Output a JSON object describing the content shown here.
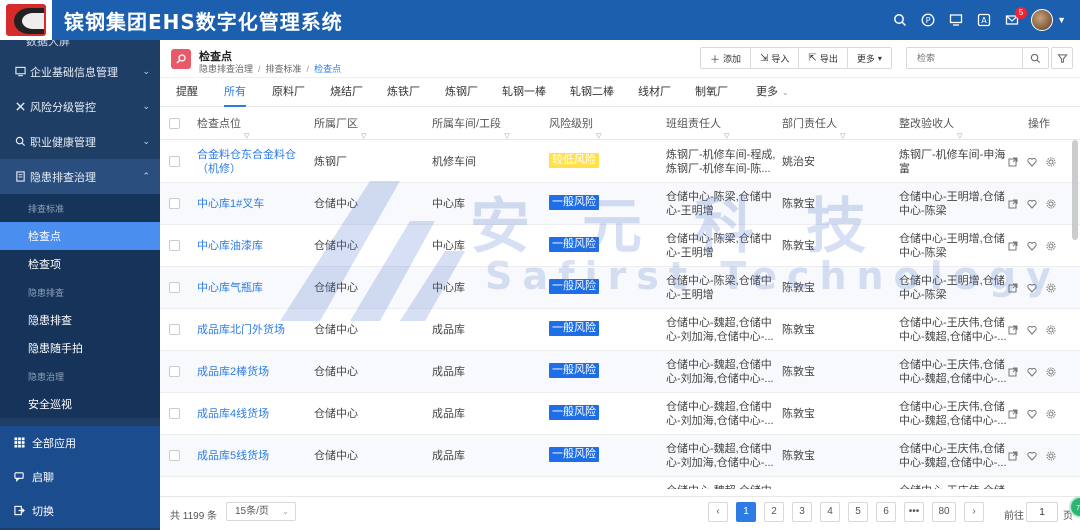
{
  "header": {
    "app_title": "镔钢集团EHS数字化管理系统",
    "icons": [
      "search-icon",
      "p-circle-icon",
      "monitor-icon",
      "a-box-icon",
      "mail-icon"
    ],
    "mail_badge": "5"
  },
  "sidebar": {
    "cut_label": "数据大屏",
    "items": [
      {
        "label": "企业基础信息管理",
        "icon": "monitor-icon"
      },
      {
        "label": "风险分级管控",
        "icon": "cross-tools-icon"
      },
      {
        "label": "职业健康管理",
        "icon": "search-icon"
      },
      {
        "label": "隐患排查治理",
        "icon": "document-icon"
      }
    ],
    "sub": {
      "group1": "排查标准",
      "item1": "检查点",
      "item2": "检查项",
      "group2": "隐患排查",
      "item3": "隐患排查",
      "item4": "隐患随手拍",
      "group3": "隐患治理",
      "item5": "安全巡视"
    },
    "bottom": {
      "all_apps": "全部应用",
      "lobby": "启聊",
      "switch": "切换"
    }
  },
  "page": {
    "title": "检查点",
    "breadcrumb": [
      "隐患排查治理",
      "排查标准",
      "检查点"
    ]
  },
  "toolbar": {
    "add": "添加",
    "import": "导入",
    "export": "导出",
    "more": "更多"
  },
  "search": {
    "placeholder": "检索"
  },
  "tabs": [
    "提醒",
    "所有",
    "原料厂",
    "烧结厂",
    "炼铁厂",
    "炼钢厂",
    "轧钢一棒",
    "轧钢二棒",
    "线材厂",
    "制氧厂",
    "更多"
  ],
  "table": {
    "columns": [
      "检查点位",
      "所属厂区",
      "所属车间/工段",
      "风险级别",
      "班组责任人",
      "部门责任人",
      "整改验收人",
      "操作"
    ],
    "rows": [
      {
        "point": [
          "合金料仓东合金料仓",
          "（机修）"
        ],
        "plant": "炼钢厂",
        "workshop": "机修车间",
        "risk": "较低风险",
        "team": [
          "炼钢厂-机修车间-程成,",
          "炼钢厂-机修车间-陈..."
        ],
        "dept": "姚治安",
        "accept": [
          "炼钢厂-机修车间-申海",
          "富"
        ]
      },
      {
        "point": [
          "中心库1#叉车",
          ""
        ],
        "plant": "仓储中心",
        "workshop": "中心库",
        "risk": "一般风险",
        "team": [
          "仓储中心-陈梁,仓储中",
          "心-王明增"
        ],
        "dept": "陈敦宝",
        "accept": [
          "仓储中心-王明增,仓储",
          "中心-陈梁"
        ]
      },
      {
        "point": [
          "中心库油漆库",
          ""
        ],
        "plant": "仓储中心",
        "workshop": "中心库",
        "risk": "一般风险",
        "team": [
          "仓储中心-陈梁,仓储中",
          "心-王明增"
        ],
        "dept": "陈敦宝",
        "accept": [
          "仓储中心-王明增,仓储",
          "中心-陈梁"
        ]
      },
      {
        "point": [
          "中心库气瓶库",
          ""
        ],
        "plant": "仓储中心",
        "workshop": "中心库",
        "risk": "一般风险",
        "team": [
          "仓储中心-陈梁,仓储中",
          "心-王明增"
        ],
        "dept": "陈敦宝",
        "accept": [
          "仓储中心-王明增,仓储",
          "中心-陈梁"
        ]
      },
      {
        "point": [
          "成品库北门外货场",
          ""
        ],
        "plant": "仓储中心",
        "workshop": "成品库",
        "risk": "一般风险",
        "team": [
          "仓储中心-魏超,仓储中",
          "心-刘加海,仓储中心-..."
        ],
        "dept": "陈敦宝",
        "accept": [
          "仓储中心-王庆伟,仓储",
          "中心-魏超,仓储中心-..."
        ]
      },
      {
        "point": [
          "成品库2棒货场",
          ""
        ],
        "plant": "仓储中心",
        "workshop": "成品库",
        "risk": "一般风险",
        "team": [
          "仓储中心-魏超,仓储中",
          "心-刘加海,仓储中心-..."
        ],
        "dept": "陈敦宝",
        "accept": [
          "仓储中心-王庆伟,仓储",
          "中心-魏超,仓储中心-..."
        ]
      },
      {
        "point": [
          "成品库4线货场",
          ""
        ],
        "plant": "仓储中心",
        "workshop": "成品库",
        "risk": "一般风险",
        "team": [
          "仓储中心-魏超,仓储中",
          "心-刘加海,仓储中心-..."
        ],
        "dept": "陈敦宝",
        "accept": [
          "仓储中心-王庆伟,仓储",
          "中心-魏超,仓储中心-..."
        ]
      },
      {
        "point": [
          "成品库5线货场",
          ""
        ],
        "plant": "仓储中心",
        "workshop": "成品库",
        "risk": "一般风险",
        "team": [
          "仓储中心-魏超,仓储中",
          "心-刘加海,仓储中心-..."
        ],
        "dept": "陈敦宝",
        "accept": [
          "仓储中心-王庆伟,仓储",
          "中心-魏超,仓储中心-..."
        ]
      },
      {
        "point": [
          "",
          ""
        ],
        "plant": "",
        "workshop": "",
        "risk": "一般风险",
        "team": [
          "仓储中心-魏超,仓储中",
          ""
        ],
        "dept": "",
        "accept": [
          "仓储中心-王庆伟,仓储",
          ""
        ]
      }
    ]
  },
  "watermark": {
    "cn": "安元科技",
    "en": "Safirst Technology"
  },
  "footer": {
    "total": "共 1199 条",
    "page_size": "15条/页",
    "pages": [
      "1",
      "2",
      "3",
      "4",
      "5",
      "6",
      "•••",
      "80"
    ],
    "goto_label": "前往",
    "goto_value": "1",
    "goto_suffix": "页"
  },
  "float_button": "71",
  "colors": {
    "header": "#1b5fae",
    "sidebar": "#1f3e66",
    "accent": "#2d7be5",
    "risk_general": "#1e6ee8",
    "risk_low": "#ffe14d"
  }
}
